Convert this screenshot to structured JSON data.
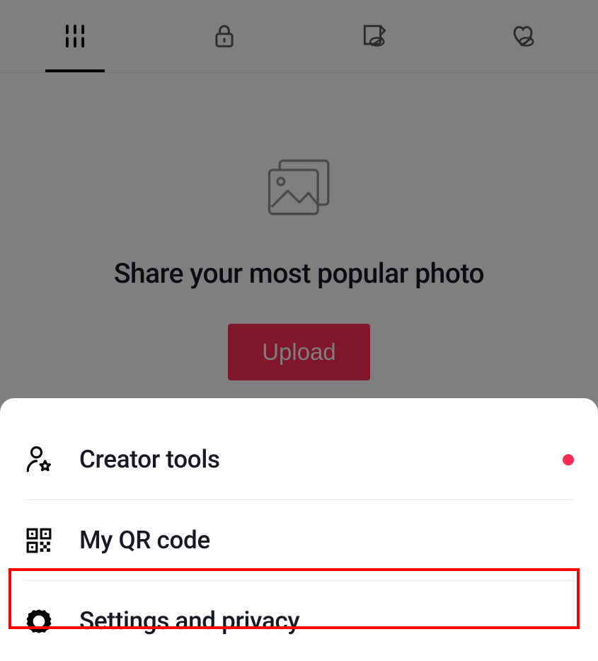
{
  "tabs": [
    "grid",
    "lock",
    "repost-hidden",
    "heart-hidden"
  ],
  "empty_state": {
    "headline": "Share your most popular photo",
    "cta": "Upload"
  },
  "menu": {
    "items": [
      {
        "label": "Creator tools",
        "has_dot": true
      },
      {
        "label": "My QR code"
      },
      {
        "label": "Settings and privacy"
      }
    ]
  },
  "colors": {
    "accent": "#fe2c55"
  }
}
